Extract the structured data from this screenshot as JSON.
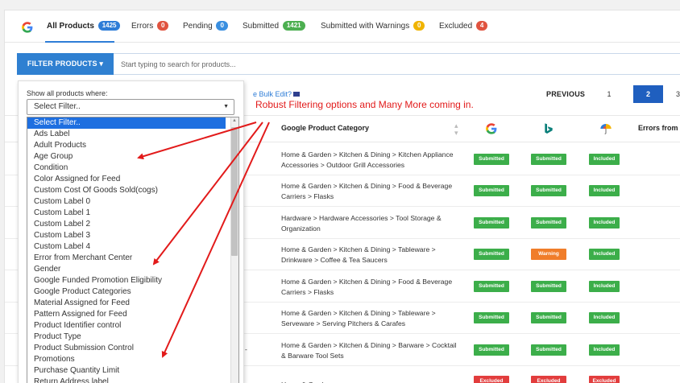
{
  "tabs": [
    {
      "label": "All Products",
      "count": "1425",
      "color": "#2e7dd7"
    },
    {
      "label": "Errors",
      "count": "0",
      "color": "#e0533f"
    },
    {
      "label": "Pending",
      "count": "0",
      "color": "#3a8fe0"
    },
    {
      "label": "Submitted",
      "count": "1421",
      "color": "#4caf50"
    },
    {
      "label": "Submitted with Warnings",
      "count": "0",
      "color": "#f0b400"
    },
    {
      "label": "Excluded",
      "count": "4",
      "color": "#e0533f"
    }
  ],
  "filter": {
    "button_label": "FILTER PRODUCTS ▾",
    "search_placeholder": "Start typing to search for products...",
    "panel_label": "Show all products where:",
    "select_value": "Select Filter..",
    "options": [
      "Select Filter..",
      "Ads Label",
      "Adult Products",
      "Age Group",
      "Condition",
      "Color Assigned for Feed",
      "Custom Cost Of Goods Sold(cogs)",
      "Custom Label 0",
      "Custom Label 1",
      "Custom Label 2",
      "Custom Label 3",
      "Custom Label 4",
      "Error from Merchant Center",
      "Gender",
      "Google Funded Promotion Eligibility",
      "Google Product Categories",
      "Material Assigned for Feed",
      "Pattern Assigned for Feed",
      "Product Identifier control",
      "Product Type",
      "Product Submission Control",
      "Promotions",
      "Purchase Quantity Limit",
      "Return Address label"
    ]
  },
  "toolbar": {
    "bulk_edit": "e Bulk Edit?",
    "previous": "PREVIOUS",
    "pages": [
      "1",
      "2",
      "3"
    ]
  },
  "annotation": "Robust Filtering options and Many More coming in.",
  "table": {
    "headers": {
      "category": "Google Product Category",
      "errors": "Errors from M"
    },
    "header_icons": [
      "google-icon",
      "bing-icon",
      "meta-umbrella-icon"
    ],
    "rows": [
      {
        "category": "Home & Garden > Kitchen & Dining > Kitchen Appliance Accessories > Outdoor Grill Accessories",
        "google": "Submitted",
        "bing": "Submitted",
        "meta": "Included",
        "frag": "s"
      },
      {
        "category": "Home & Garden > Kitchen & Dining > Food & Beverage Carriers > Flasks",
        "google": "Submitted",
        "bing": "Submitted",
        "meta": "Included",
        "frag": ""
      },
      {
        "category": "Hardware > Hardware Accessories > Tool Storage & Organization",
        "google": "Submitted",
        "bing": "Submitted",
        "meta": "Included",
        "frag": ""
      },
      {
        "category": "Home & Garden > Kitchen & Dining > Tableware > Drinkware > Coffee & Tea Saucers",
        "google": "Submitted",
        "bing": "Warning",
        "meta": "Included",
        "frag": ""
      },
      {
        "category": "Home & Garden > Kitchen & Dining > Food & Beverage Carriers > Flasks",
        "google": "Submitted",
        "bing": "Submitted",
        "meta": "Included",
        "frag": ""
      },
      {
        "category": "Home & Garden > Kitchen & Dining > Tableware > Serveware > Serving Pitchers & Carafes",
        "google": "Submitted",
        "bing": "Submitted",
        "meta": "Included",
        "frag": ""
      },
      {
        "category": "Home & Garden > Kitchen & Dining > Barware > Cocktail & Barware Tool Sets",
        "google": "Submitted",
        "bing": "Submitted",
        "meta": "Included",
        "frag": "ne -"
      },
      {
        "category": "Home & Garden",
        "google": "Excluded",
        "bing": "Excluded",
        "meta": "Excluded",
        "frag": ""
      }
    ]
  }
}
